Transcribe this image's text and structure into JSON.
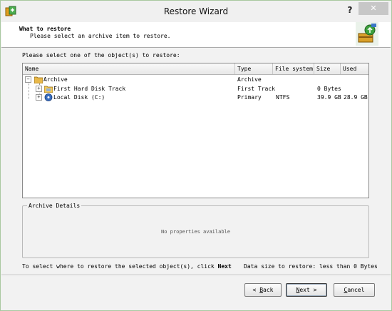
{
  "window": {
    "title": "Restore Wizard",
    "help_label": "?",
    "close_label": "✕"
  },
  "header": {
    "title": "What to restore",
    "subtitle": "Please select an archive item to restore."
  },
  "prompt": "Please select one of the object(s) to restore:",
  "columns": [
    "Name",
    "Type",
    "File system",
    "Size",
    "Used"
  ],
  "tree": {
    "root": {
      "name": "Archive",
      "type": "Archive",
      "expander": "−"
    },
    "children": [
      {
        "name": "First Hard Disk Track",
        "type": "First Track",
        "fs": "",
        "size": "0 Bytes",
        "used": "",
        "expander": "+"
      },
      {
        "name": "Local Disk (C:)",
        "type": "Primary",
        "fs": "NTFS",
        "size": "39.9 GB",
        "used": "28.9 GB",
        "expander": "+"
      }
    ]
  },
  "details": {
    "legend": "Archive Details",
    "empty_text": "No properties available"
  },
  "hint": {
    "prefix": "To select where to restore the selected object(s), click ",
    "bold": "Next"
  },
  "data_size": "Data size to restore: less than 0 Bytes",
  "buttons": {
    "back_arrow": "<",
    "back_key": "B",
    "back_rest": "ack",
    "next_key": "N",
    "next_rest": "ext",
    "next_arrow": ">",
    "cancel_key": "C",
    "cancel_rest": "ancel"
  },
  "colors": {
    "window_bg": "#f2f2f2",
    "desktop_green": "#6faa2e"
  }
}
